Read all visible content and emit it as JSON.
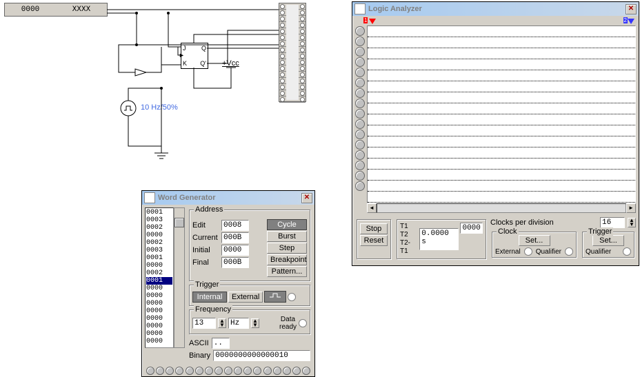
{
  "circuit": {
    "display_left": "0000",
    "display_right": "XXXX",
    "clock_label": "10 Hz/50%",
    "vcc_label": "+Vcc",
    "jk": {
      "j": "J",
      "k": "K",
      "q": "Q",
      "qn": "Q'",
      "clk_mark": "►"
    }
  },
  "word_generator": {
    "title": "Word Generator",
    "address": {
      "legend": "Address",
      "edit_label": "Edit",
      "edit_value": "0008",
      "current_label": "Current",
      "current_value": "000B",
      "initial_label": "Initial",
      "initial_value": "0000",
      "final_label": "Final",
      "final_value": "000B"
    },
    "controls": {
      "cycle": "Cycle",
      "burst": "Burst",
      "step": "Step",
      "breakpoint": "Breakpoint",
      "pattern": "Pattern..."
    },
    "trigger": {
      "legend": "Trigger",
      "internal": "Internal",
      "external": "External"
    },
    "frequency": {
      "legend": "Frequency",
      "value": "13",
      "unit": "Hz",
      "data_ready": "Data\nready"
    },
    "ascii_label": "ASCII",
    "ascii_value": "..",
    "binary_label": "Binary",
    "binary_value": "0000000000000010",
    "list": [
      "0001",
      "0003",
      "0002",
      "0000",
      "0002",
      "0003",
      "0001",
      "0000",
      "0002",
      "0001",
      "0000",
      "0000",
      "0000",
      "0000",
      "0000",
      "0000",
      "0000",
      "0000"
    ],
    "list_selected_index": 9
  },
  "logic_analyzer": {
    "title": "Logic Analyzer",
    "stop": "Stop",
    "reset": "Reset",
    "t1_label": "T1",
    "t2_label": "T2",
    "t2t1_label": "T2-T1",
    "time_value": "0.0000 s",
    "time_right": "0000",
    "cpd_label": "Clocks per division",
    "cpd_value": "16",
    "clock_label": "Clock",
    "trigger_label": "Trigger",
    "external_label": "External",
    "qualifier_label": "Qualifier",
    "set": "Set..."
  }
}
